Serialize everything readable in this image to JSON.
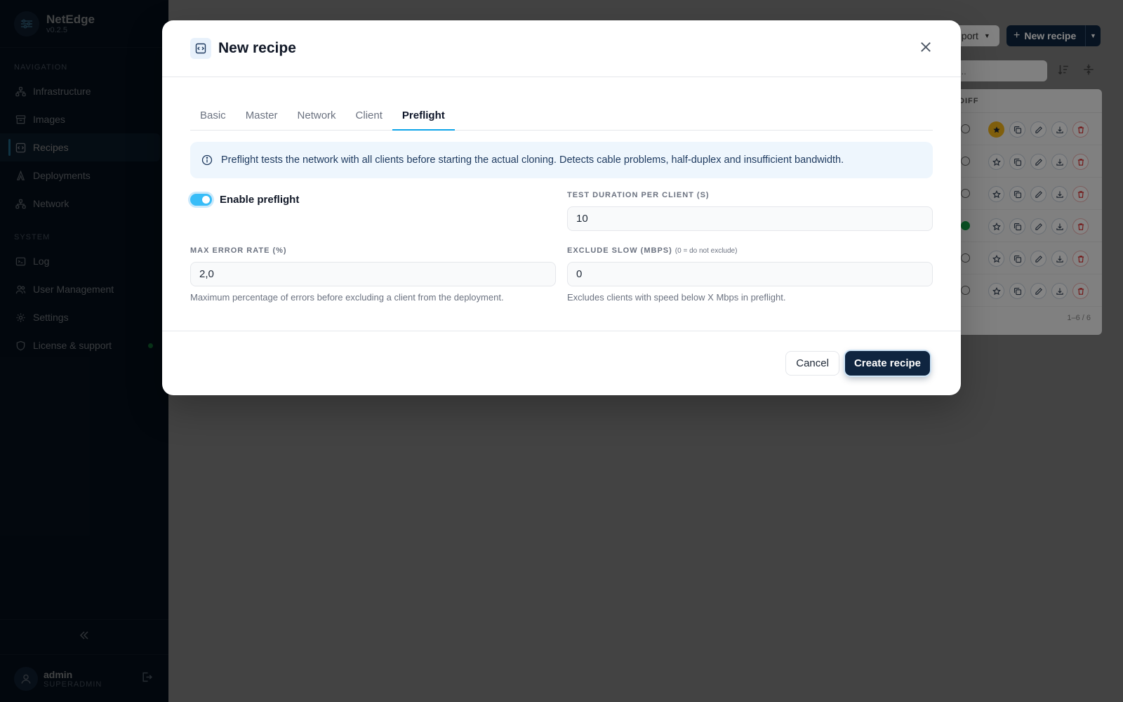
{
  "app": {
    "name": "NetEdge",
    "version": "v0.2.5"
  },
  "sidebar": {
    "nav_heading": "NAVIGATION",
    "nav_items": [
      {
        "label": "Infrastructure",
        "icon": "network-nodes-icon"
      },
      {
        "label": "Images",
        "icon": "archive-icon"
      },
      {
        "label": "Recipes",
        "icon": "recipe-code-icon",
        "active": true
      },
      {
        "label": "Deployments",
        "icon": "rocket-icon"
      },
      {
        "label": "Network",
        "icon": "network-nodes-icon"
      }
    ],
    "system_heading": "SYSTEM",
    "system_items": [
      {
        "label": "Log",
        "icon": "terminal-icon"
      },
      {
        "label": "User Management",
        "icon": "users-icon"
      },
      {
        "label": "Settings",
        "icon": "gear-icon"
      },
      {
        "label": "License & support",
        "icon": "shield-icon",
        "status_color": "#22c55e"
      }
    ],
    "user": {
      "name": "admin",
      "role": "SUPERADMIN"
    }
  },
  "background": {
    "import_label": "nport",
    "new_recipe_label": "New recipe",
    "search_placeholder": "cipe...",
    "table_header": "DIFF",
    "row_count": "1–6 / 6",
    "rows": [
      {
        "status": "error",
        "favorite": true
      },
      {
        "status": "error",
        "favorite": false
      },
      {
        "status": "error",
        "favorite": false
      },
      {
        "status": "ok",
        "favorite": false
      },
      {
        "status": "error",
        "favorite": false
      },
      {
        "status": "error",
        "favorite": false
      }
    ]
  },
  "modal": {
    "title": "New recipe",
    "tabs": [
      "Basic",
      "Master",
      "Network",
      "Client",
      "Preflight"
    ],
    "active_tab": "Preflight",
    "info_text": "Preflight tests the network with all clients before starting the actual cloning. Detects cable problems, half-duplex and insufficient bandwidth.",
    "enable_preflight": {
      "label": "Enable preflight",
      "enabled": true
    },
    "test_duration": {
      "label": "TEST DURATION PER CLIENT (S)",
      "value": "10"
    },
    "max_error_rate": {
      "label": "MAX ERROR RATE (%)",
      "value": "2,0",
      "help": "Maximum percentage of errors before excluding a client from the deployment."
    },
    "exclude_slow": {
      "label": "EXCLUDE SLOW (MBPS)",
      "note": "(0 = do not exclude)",
      "value": "0",
      "help": "Excludes clients with speed below X Mbps in preflight."
    },
    "cancel_label": "Cancel",
    "create_label": "Create recipe"
  },
  "colors": {
    "accent": "#0ea5e9",
    "primary": "#0f2540",
    "sidebar_bg": "#0b1d33",
    "success": "#22c55e"
  }
}
